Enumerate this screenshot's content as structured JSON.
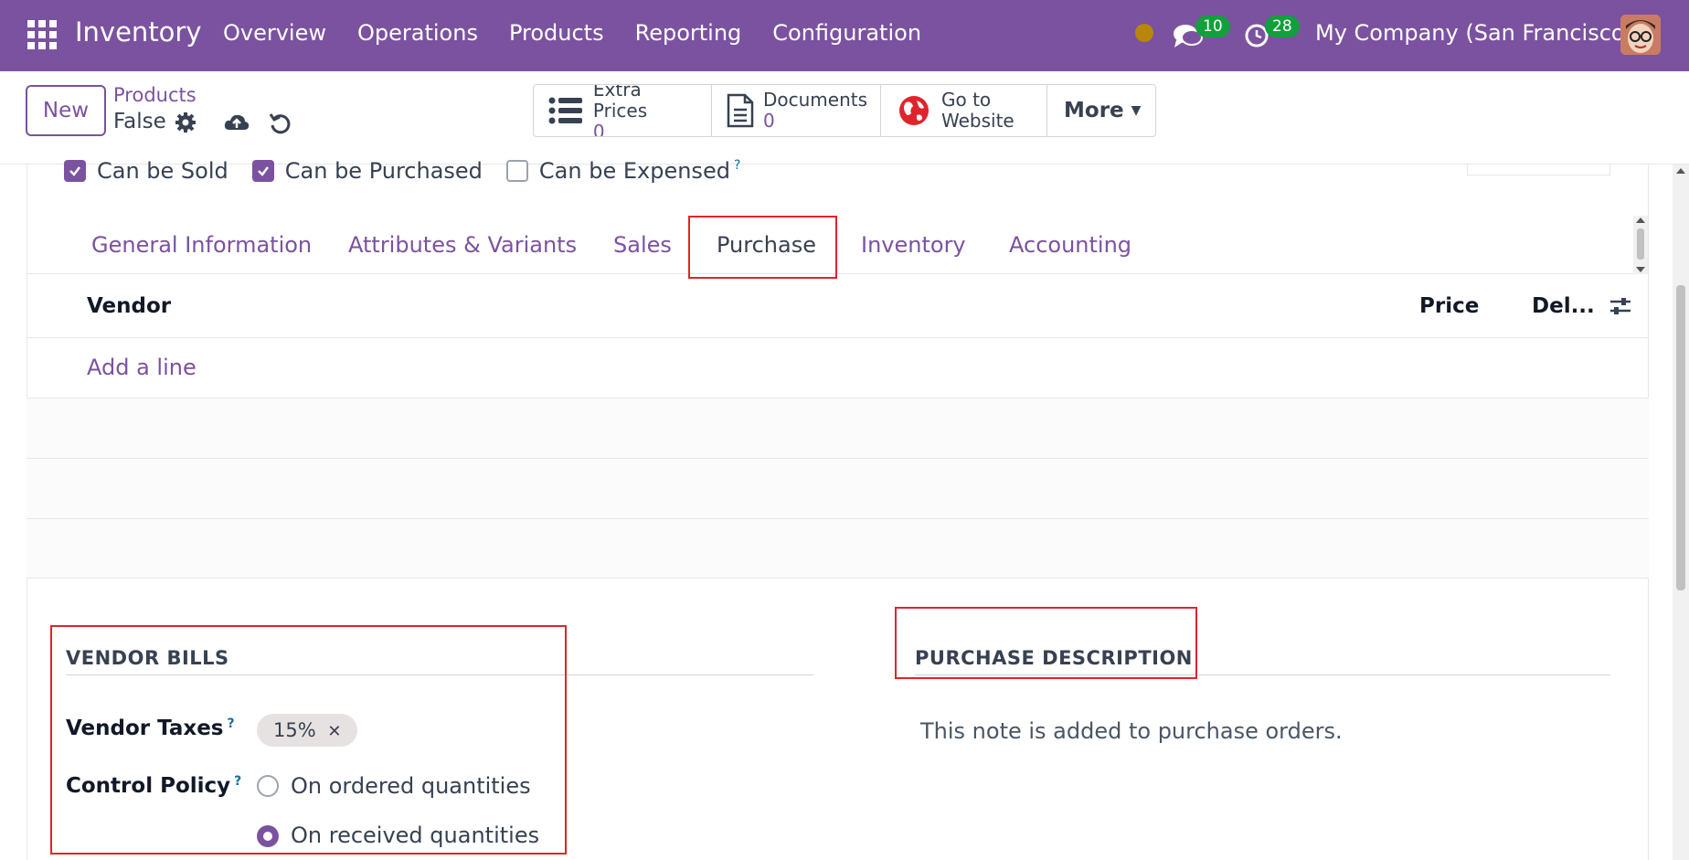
{
  "nav": {
    "app_title": "Inventory",
    "menu": [
      "Overview",
      "Operations",
      "Products",
      "Reporting",
      "Configuration"
    ],
    "messages_count": "10",
    "activities_count": "28",
    "company": "My Company (San Francisco)"
  },
  "control": {
    "new_label": "New",
    "breadcrumb": "Products",
    "record_name": "False",
    "smart_buttons": [
      {
        "label": "Extra Prices",
        "count": "0",
        "icon": "list-icon"
      },
      {
        "label": "Documents",
        "count": "0",
        "icon": "document-icon"
      },
      {
        "label": "Go to",
        "label2": "Website",
        "icon": "globe-icon"
      }
    ],
    "more_label": "More"
  },
  "checks": [
    {
      "label": "Can be Sold",
      "checked": true
    },
    {
      "label": "Can be Purchased",
      "checked": true
    },
    {
      "label": "Can be Expensed",
      "checked": false
    }
  ],
  "tabs": [
    "General Information",
    "Attributes & Variants",
    "Sales",
    "Purchase",
    "Inventory",
    "Accounting"
  ],
  "active_tab": "Purchase",
  "vendor_list": {
    "columns": [
      "Vendor",
      "Price",
      "Del..."
    ],
    "add_line": "Add a line"
  },
  "vendor_bills": {
    "title": "VENDOR BILLS",
    "taxes_label": "Vendor Taxes",
    "taxes_value": "15%",
    "policy_label": "Control Policy",
    "policy_options": [
      "On ordered quantities",
      "On received quantities"
    ],
    "policy_selected": "On received quantities"
  },
  "purchase_description": {
    "title": "PURCHASE DESCRIPTION",
    "placeholder": "This note is added to purchase orders."
  },
  "colors": {
    "brand": "#7b52a0",
    "badge": "#12a03c",
    "highlight": "#e0242c"
  }
}
